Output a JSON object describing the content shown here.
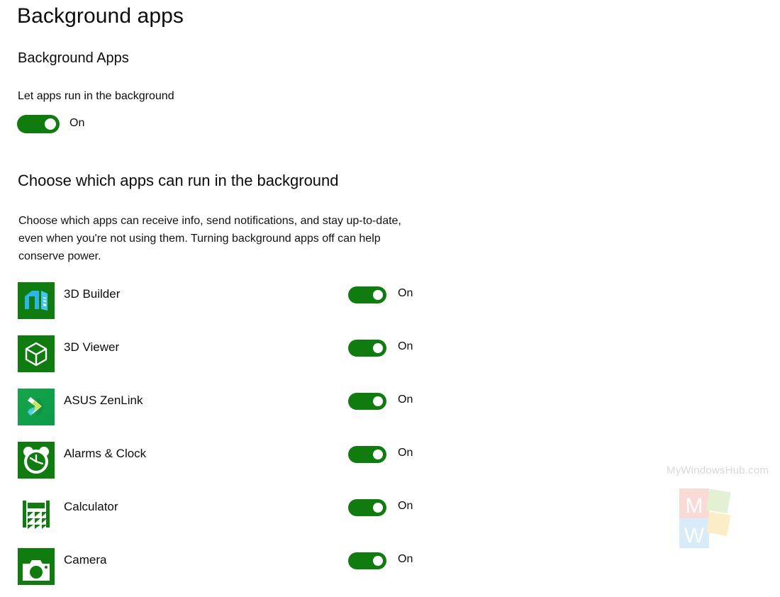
{
  "page": {
    "title": "Background apps",
    "section_title": "Background Apps",
    "setting_label": "Let apps run in the background",
    "main_toggle_state": "On",
    "choose_title": "Choose which apps can run in the background",
    "choose_description": "Choose which apps can receive info, send notifications, and stay up-to-date, even when you're not using them. Turning background apps off can help conserve power."
  },
  "colors": {
    "toggle_on": "#107C10",
    "icon_green": "#107C10",
    "icon_green_dark": "#0E7A0E",
    "text": "#0c0c0c",
    "background": "#ffffff",
    "watermark_text": "#d9d9d9"
  },
  "apps": [
    {
      "name": "3D Builder",
      "icon": "3d-builder-icon",
      "state": "On"
    },
    {
      "name": "3D Viewer",
      "icon": "3d-viewer-icon",
      "state": "On"
    },
    {
      "name": "ASUS ZenLink",
      "icon": "asus-zenlink-icon",
      "state": "On"
    },
    {
      "name": "Alarms & Clock",
      "icon": "alarms-clock-icon",
      "state": "On"
    },
    {
      "name": "Calculator",
      "icon": "calculator-icon",
      "state": "On"
    },
    {
      "name": "Camera",
      "icon": "camera-icon",
      "state": "On"
    }
  ],
  "watermark": {
    "text": "MyWindowsHub.com",
    "logo_letters": [
      "M",
      "W"
    ]
  }
}
